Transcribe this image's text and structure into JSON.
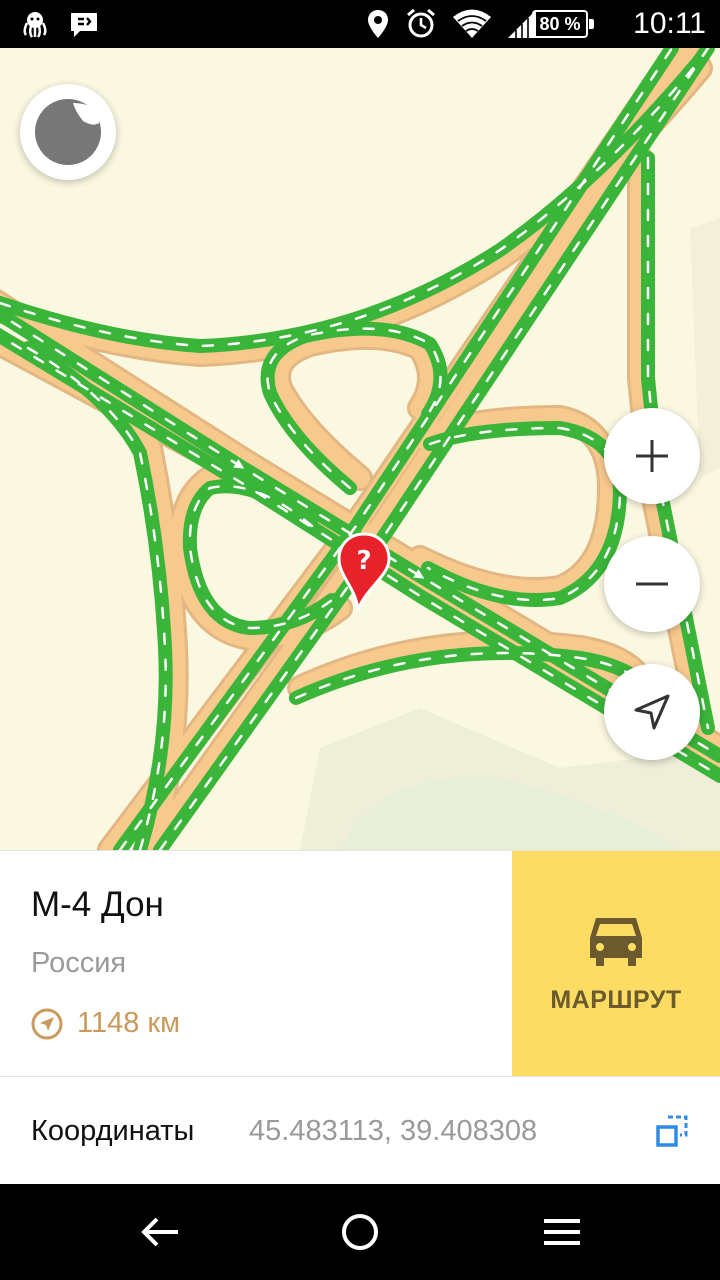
{
  "status_bar": {
    "time": "10:11",
    "battery_percent": "80 %",
    "icons": [
      "octopus-icon",
      "message-icon",
      "location-icon",
      "alarm-icon",
      "wifi-icon",
      "signal-icon",
      "battery-icon"
    ]
  },
  "map": {
    "road_color_traffic": "#3ab53a",
    "road_color_base": "#f7c98d",
    "background": "#fbf8e1",
    "controls": [
      "zoom-in-icon",
      "zoom-out-icon",
      "locate-arrow-icon"
    ]
  },
  "place_card": {
    "name": "М-4 Дон",
    "region": "Россия",
    "distance": "1148 км",
    "route_label": "МАРШРУТ",
    "accent_color": "#fddc63"
  },
  "coordinates": {
    "label": "Координаты",
    "value": "45.483113, 39.408308"
  },
  "nav_bar": {
    "icons": [
      "back-arrow-icon",
      "home-circle-icon",
      "menu-icon"
    ]
  }
}
